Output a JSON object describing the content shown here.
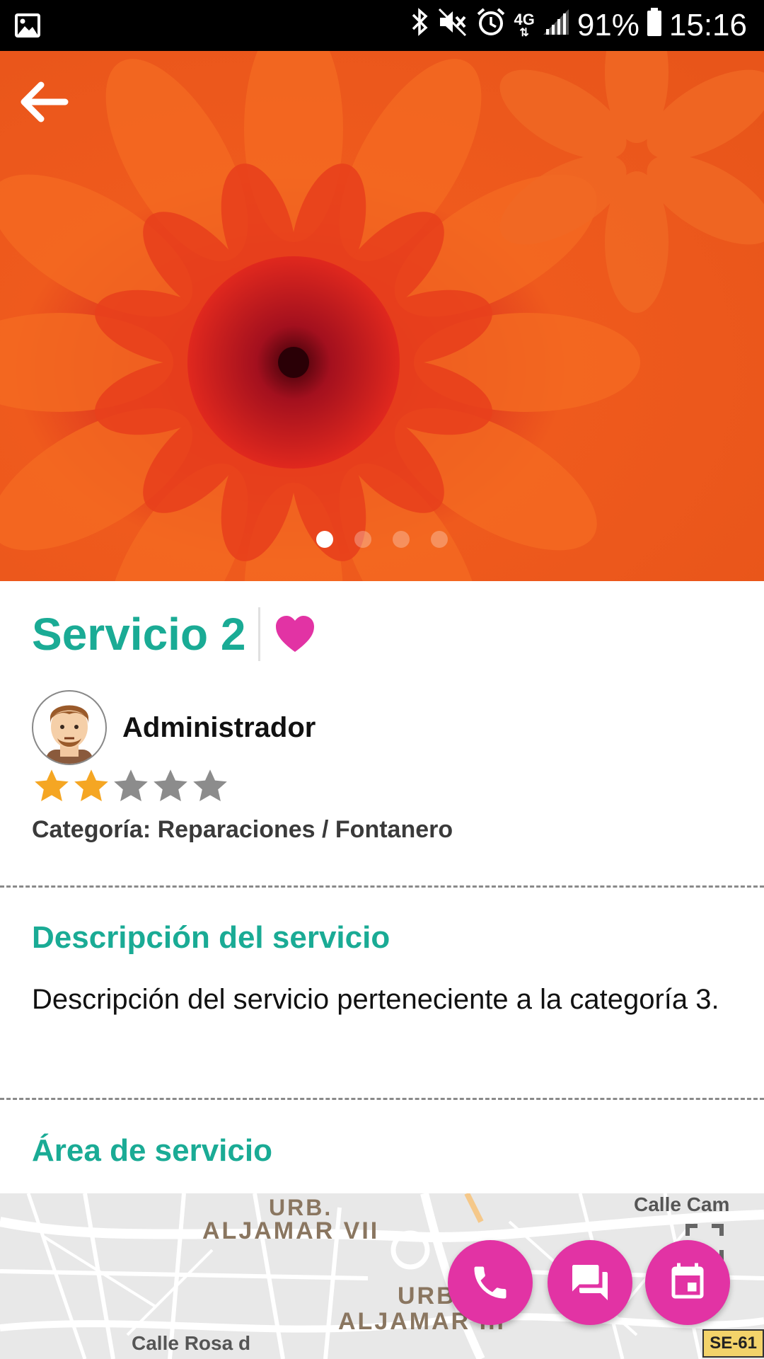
{
  "status_bar": {
    "network": "4G",
    "battery": "91%",
    "time": "15:16"
  },
  "gallery": {
    "slides": 4,
    "active_index": 0
  },
  "service": {
    "title": "Servicio 2",
    "favorite_color": "#e233a4"
  },
  "provider": {
    "name": "Administrador",
    "rating": 2,
    "rating_max": 5
  },
  "category_line": "Categoría: Reparaciones / Fontanero",
  "description": {
    "heading": "Descripción del servicio",
    "text": "Descripción del servicio perteneciente a la categoría 3."
  },
  "area": {
    "heading": "Área de servicio"
  },
  "map": {
    "labels": [
      "URB.",
      "ALJAMAR VII",
      "URB.",
      "ALJAMAR III",
      "Calle Cam",
      "Calle Rosa d",
      "SE-61"
    ]
  },
  "colors": {
    "accent": "#1aab95",
    "fab": "#e233a4",
    "star_on": "#f5a623",
    "star_off": "#8c8c8c"
  }
}
